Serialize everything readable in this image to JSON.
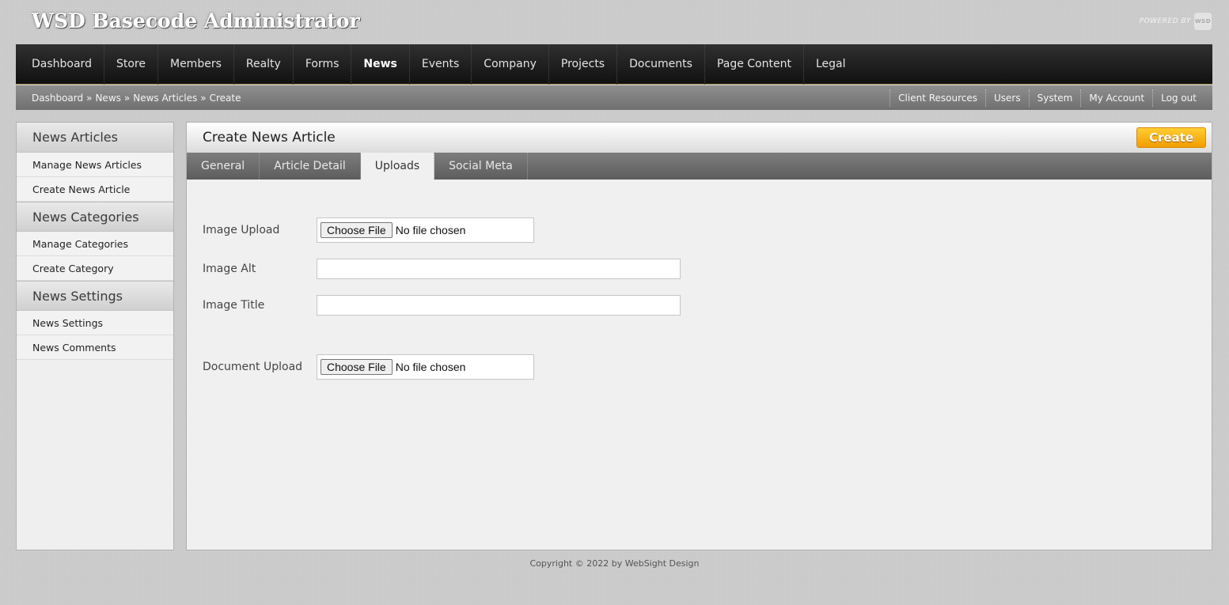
{
  "site": {
    "title": "WSD Basecode Administrator",
    "powered_by": "POWERED BY",
    "logo_text": "WSD"
  },
  "main_nav": {
    "items": [
      "Dashboard",
      "Store",
      "Members",
      "Realty",
      "Forms",
      "News",
      "Events",
      "Company",
      "Projects",
      "Documents",
      "Page Content",
      "Legal"
    ],
    "active": "News"
  },
  "breadcrumb": {
    "items": [
      "Dashboard",
      "News",
      "News Articles",
      "Create"
    ],
    "separator": "»"
  },
  "util_nav": {
    "items": [
      "Client Resources",
      "Users",
      "System",
      "My Account",
      "Log out"
    ]
  },
  "sidebar": {
    "sections": [
      {
        "heading": "News Articles",
        "items": [
          "Manage News Articles",
          "Create News Article"
        ]
      },
      {
        "heading": "News Categories",
        "items": [
          "Manage Categories",
          "Create Category"
        ]
      },
      {
        "heading": "News Settings",
        "items": [
          "News Settings",
          "News Comments"
        ]
      }
    ]
  },
  "content": {
    "title": "Create News Article",
    "create_label": "Create",
    "tabs": [
      "General",
      "Article Detail",
      "Uploads",
      "Social Meta"
    ],
    "active_tab": "Uploads",
    "form": {
      "image_upload_label": "Image Upload",
      "image_alt_label": "Image Alt",
      "image_title_label": "Image Title",
      "document_upload_label": "Document Upload",
      "choose_file_label": "Choose File",
      "no_file_text": "No file chosen",
      "image_alt_value": "",
      "image_title_value": ""
    }
  },
  "footer": {
    "copyright": "Copyright © 2022 by WebSight Design"
  },
  "colors": {
    "accent": "#f29d00",
    "nav_bg": "#1a1a1a"
  }
}
